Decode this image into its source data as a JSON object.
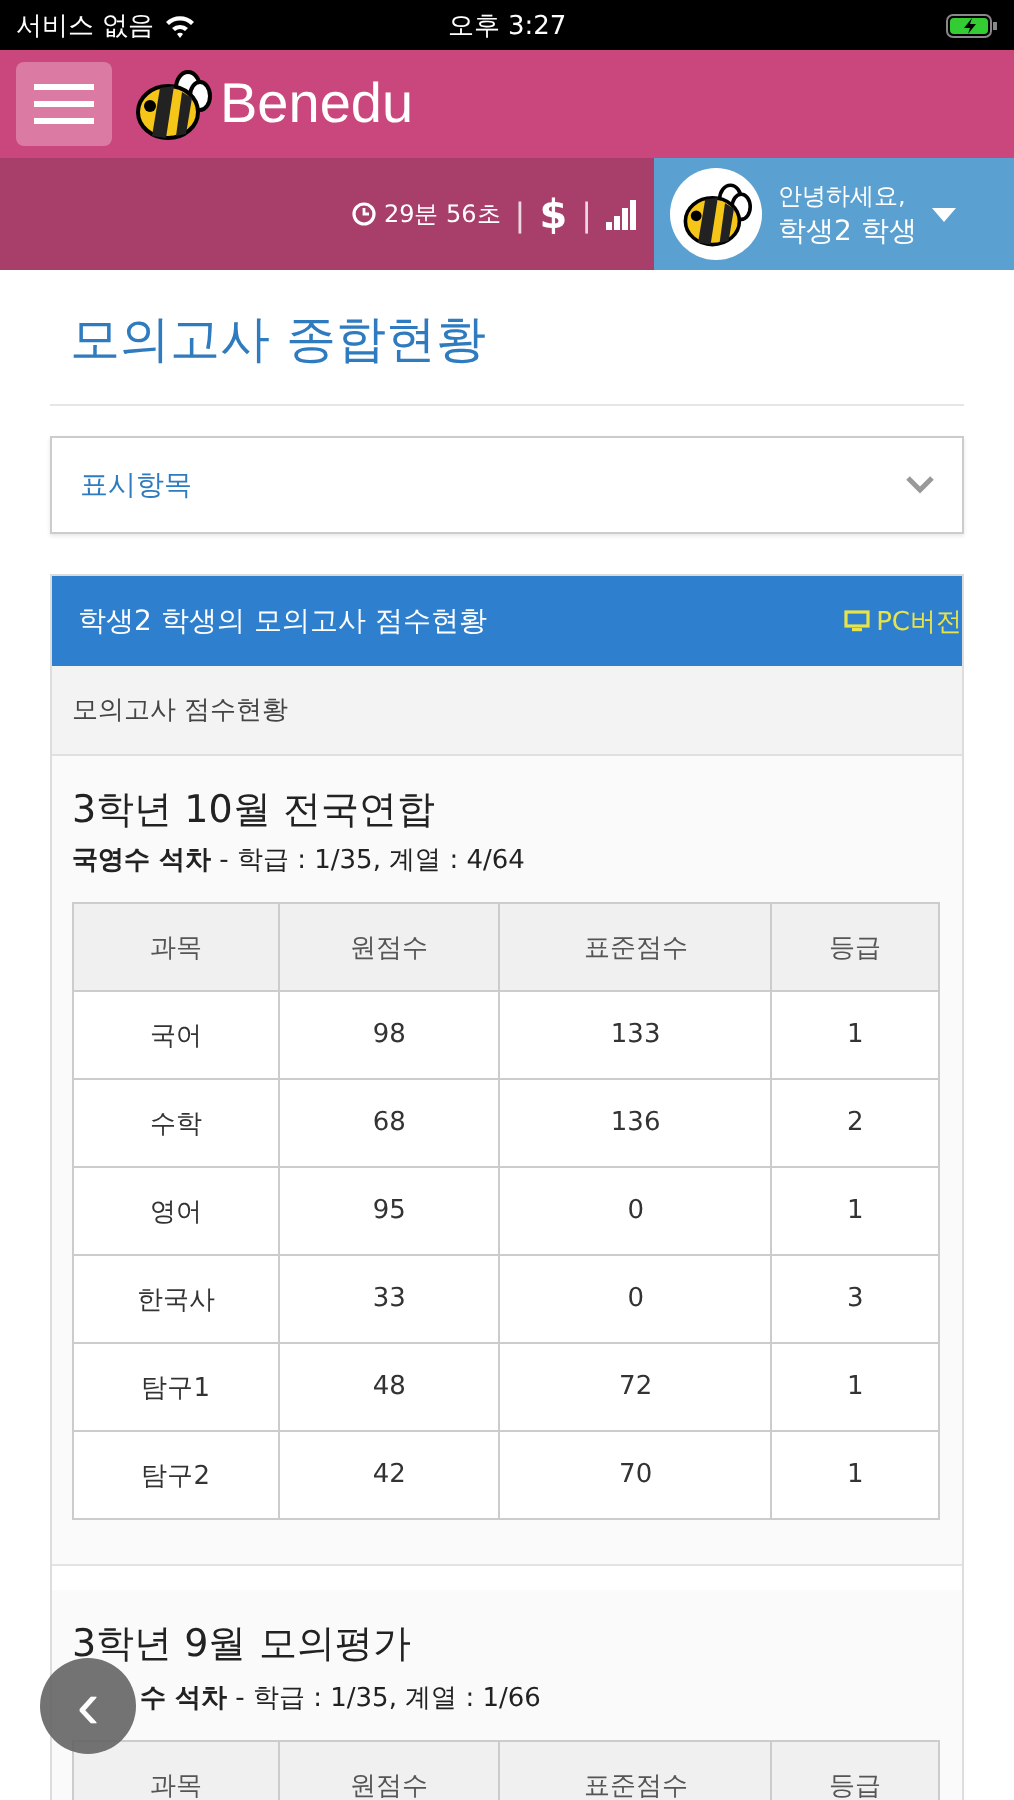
{
  "status_bar": {
    "carrier": "서비스 없음",
    "time": "오후 3:27"
  },
  "header": {
    "brand": "Benedu"
  },
  "info_bar": {
    "timer": "29분 56초",
    "separator_1": "|",
    "currency": "$",
    "separator_2": "|",
    "greeting": "안녕하세요,",
    "user": "학생2 학생"
  },
  "page_title": "모의고사 종합현황",
  "display_dropdown": {
    "label": "표시항목",
    "expanded": false
  },
  "panel": {
    "title": "학생2 학생의 모의고사 점수현황",
    "pc_link": "PC버전",
    "subtitle": "모의고사 점수현황"
  },
  "exams": [
    {
      "title": "3학년 10월 전국연합",
      "rank": "**국영수 석차** - 학급 : 1/35, 계열 : 4/64",
      "covered": false,
      "columns": [
        "과목",
        "원점수",
        "표준점수",
        "등급"
      ],
      "rows": [
        [
          "국어",
          "98",
          "133",
          "1"
        ],
        [
          "수학",
          "68",
          "136",
          "2"
        ],
        [
          "영어",
          "95",
          "0",
          "1"
        ],
        [
          "한국사",
          "33",
          "0",
          "3"
        ],
        [
          "탐구1",
          "48",
          "72",
          "1"
        ],
        [
          "탐구2",
          "42",
          "70",
          "1"
        ]
      ]
    },
    {
      "title": "3학년 9월 모의평가",
      "rank": "**수 석차** - 학급 : 1/35, 계열 : 1/66",
      "covered": true,
      "columns": [
        "과목",
        "원점수",
        "표준점수",
        "등급"
      ]
    }
  ],
  "back_button": {
    "label": "‹"
  }
}
